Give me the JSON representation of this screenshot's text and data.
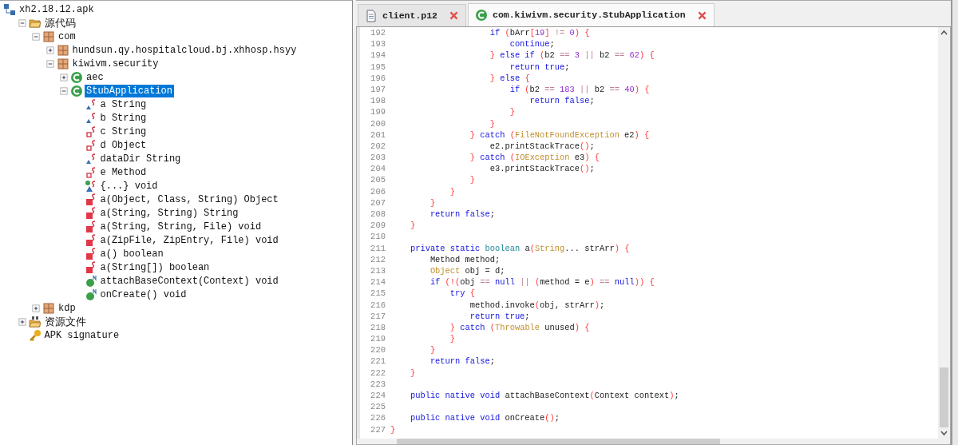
{
  "tree": {
    "label": "xh2.18.12.apk",
    "kind": "apk",
    "children": [
      {
        "label": "源代码",
        "kind": "folder",
        "expanded": true,
        "children": [
          {
            "label": "com",
            "kind": "package",
            "expanded": true,
            "children": [
              {
                "label": "hundsun.qy.hospitalcloud.bj.xhhosp.hsyy",
                "kind": "package",
                "expanded": false
              },
              {
                "label": "kiwivm.security",
                "kind": "package",
                "expanded": true,
                "children": [
                  {
                    "label": "aec",
                    "kind": "class",
                    "expanded": false,
                    "selected": false
                  },
                  {
                    "label": "StubApplication",
                    "kind": "class",
                    "expanded": true,
                    "selected": true,
                    "children": [
                      {
                        "label": "a String",
                        "kind": "final-field"
                      },
                      {
                        "label": "b String",
                        "kind": "final-field"
                      },
                      {
                        "label": "c String",
                        "kind": "private-field"
                      },
                      {
                        "label": "d Object",
                        "kind": "private-field"
                      },
                      {
                        "label": "dataDir String",
                        "kind": "final-field"
                      },
                      {
                        "label": "e Method",
                        "kind": "private-field"
                      },
                      {
                        "label": "{...} void",
                        "kind": "initializer"
                      },
                      {
                        "label": "a(Object, Class, String) Object",
                        "kind": "method"
                      },
                      {
                        "label": "a(String, String) String",
                        "kind": "method"
                      },
                      {
                        "label": "a(String, String, File) void",
                        "kind": "method"
                      },
                      {
                        "label": "a(ZipFile, ZipEntry, File) void",
                        "kind": "method"
                      },
                      {
                        "label": "a() boolean",
                        "kind": "method"
                      },
                      {
                        "label": "a(String[]) boolean",
                        "kind": "method"
                      },
                      {
                        "label": "attachBaseContext(Context) void",
                        "kind": "native"
                      },
                      {
                        "label": "onCreate() void",
                        "kind": "native"
                      }
                    ]
                  }
                ]
              }
            ]
          },
          {
            "label": "kdp",
            "kind": "package",
            "expanded": false
          }
        ]
      },
      {
        "label": "资源文件",
        "kind": "resources",
        "expanded": false
      },
      {
        "label": "APK signature",
        "kind": "key"
      }
    ]
  },
  "tabs": [
    {
      "label": "client.p12",
      "kind": "file",
      "selected": false
    },
    {
      "label": "com.kiwivm.security.StubApplication",
      "kind": "class",
      "selected": true
    }
  ],
  "code": [
    {
      "number": "192",
      "tokens": [
        {
          "kind": "keyword",
          "text": "                    if"
        },
        {
          "kind": "bracket",
          "text": " ("
        },
        {
          "kind": "plain",
          "text": "bArr"
        },
        {
          "kind": "bracket",
          "text": "["
        },
        {
          "kind": "number",
          "text": "19"
        },
        {
          "kind": "bracket",
          "text": "]"
        },
        {
          "kind": "operator",
          "text": " !="
        },
        {
          "kind": "number",
          "text": " 0"
        },
        {
          "kind": "bracket",
          "text": ")"
        },
        {
          "kind": "bracket",
          "text": " {"
        }
      ]
    },
    {
      "number": "193",
      "tokens": [
        {
          "kind": "keyword",
          "text": "                        continue"
        },
        {
          "kind": "plain",
          "text": ";"
        }
      ]
    },
    {
      "number": "194",
      "tokens": [
        {
          "kind": "bracket",
          "text": "                    }"
        },
        {
          "kind": "keyword",
          "text": " else if"
        },
        {
          "kind": "bracket",
          "text": " ("
        },
        {
          "kind": "plain",
          "text": "b2"
        },
        {
          "kind": "operator",
          "text": " =="
        },
        {
          "kind": "number",
          "text": " 3"
        },
        {
          "kind": "operator",
          "text": " ||"
        },
        {
          "kind": "plain",
          "text": " b2"
        },
        {
          "kind": "operator",
          "text": " =="
        },
        {
          "kind": "number",
          "text": " 62"
        },
        {
          "kind": "bracket",
          "text": ")"
        },
        {
          "kind": "bracket",
          "text": " {"
        }
      ]
    },
    {
      "number": "195",
      "tokens": [
        {
          "kind": "keyword",
          "text": "                        return true"
        },
        {
          "kind": "plain",
          "text": ";"
        }
      ]
    },
    {
      "number": "196",
      "tokens": [
        {
          "kind": "bracket",
          "text": "                    }"
        },
        {
          "kind": "keyword",
          "text": " else"
        },
        {
          "kind": "bracket",
          "text": " {"
        }
      ]
    },
    {
      "number": "197",
      "tokens": [
        {
          "kind": "keyword",
          "text": "                        if"
        },
        {
          "kind": "bracket",
          "text": " ("
        },
        {
          "kind": "plain",
          "text": "b2"
        },
        {
          "kind": "operator",
          "text": " =="
        },
        {
          "kind": "number",
          "text": " 183"
        },
        {
          "kind": "operator",
          "text": " ||"
        },
        {
          "kind": "plain",
          "text": " b2"
        },
        {
          "kind": "operator",
          "text": " =="
        },
        {
          "kind": "number",
          "text": " 40"
        },
        {
          "kind": "bracket",
          "text": ")"
        },
        {
          "kind": "bracket",
          "text": " {"
        }
      ]
    },
    {
      "number": "198",
      "tokens": [
        {
          "kind": "keyword",
          "text": "                            return false"
        },
        {
          "kind": "plain",
          "text": ";"
        }
      ]
    },
    {
      "number": "199",
      "tokens": [
        {
          "kind": "bracket",
          "text": "                        }"
        }
      ]
    },
    {
      "number": "200",
      "tokens": [
        {
          "kind": "bracket",
          "text": "                    }"
        }
      ]
    },
    {
      "number": "201",
      "tokens": [
        {
          "kind": "bracket",
          "text": "                }"
        },
        {
          "kind": "keyword",
          "text": " catch"
        },
        {
          "kind": "bracket",
          "text": " ("
        },
        {
          "kind": "type",
          "text": "FileNotFoundException"
        },
        {
          "kind": "plain",
          "text": " e2"
        },
        {
          "kind": "bracket",
          "text": ")"
        },
        {
          "kind": "bracket",
          "text": " {"
        }
      ]
    },
    {
      "number": "202",
      "tokens": [
        {
          "kind": "plain",
          "text": "                    e2.printStackTrace"
        },
        {
          "kind": "bracket",
          "text": "()"
        },
        {
          "kind": "plain",
          "text": ";"
        }
      ]
    },
    {
      "number": "203",
      "tokens": [
        {
          "kind": "bracket",
          "text": "                }"
        },
        {
          "kind": "keyword",
          "text": " catch"
        },
        {
          "kind": "bracket",
          "text": " ("
        },
        {
          "kind": "type",
          "text": "IOException"
        },
        {
          "kind": "plain",
          "text": " e3"
        },
        {
          "kind": "bracket",
          "text": ")"
        },
        {
          "kind": "bracket",
          "text": " {"
        }
      ]
    },
    {
      "number": "204",
      "tokens": [
        {
          "kind": "plain",
          "text": "                    e3.printStackTrace"
        },
        {
          "kind": "bracket",
          "text": "()"
        },
        {
          "kind": "plain",
          "text": ";"
        }
      ]
    },
    {
      "number": "205",
      "tokens": [
        {
          "kind": "bracket",
          "text": "                }"
        }
      ]
    },
    {
      "number": "206",
      "tokens": [
        {
          "kind": "bracket",
          "text": "            }"
        }
      ]
    },
    {
      "number": "207",
      "tokens": [
        {
          "kind": "bracket",
          "text": "        }"
        }
      ]
    },
    {
      "number": "208",
      "tokens": [
        {
          "kind": "keyword",
          "text": "        return false"
        },
        {
          "kind": "plain",
          "text": ";"
        }
      ]
    },
    {
      "number": "209",
      "tokens": [
        {
          "kind": "bracket",
          "text": "    }"
        }
      ]
    },
    {
      "number": "210"
    },
    {
      "number": "211",
      "tokens": [
        {
          "kind": "keyword",
          "text": "    private static"
        },
        {
          "kind": "primitive",
          "text": " boolean"
        },
        {
          "kind": "plain",
          "text": " a"
        },
        {
          "kind": "bracket",
          "text": "("
        },
        {
          "kind": "type",
          "text": "String"
        },
        {
          "kind": "plain",
          "text": "... strArr"
        },
        {
          "kind": "bracket",
          "text": ")"
        },
        {
          "kind": "bracket",
          "text": " {"
        }
      ]
    },
    {
      "number": "212",
      "tokens": [
        {
          "kind": "plain",
          "text": "        Method method;"
        }
      ]
    },
    {
      "number": "213",
      "tokens": [
        {
          "kind": "type",
          "text": "        Object"
        },
        {
          "kind": "plain",
          "text": " obj = d;"
        }
      ]
    },
    {
      "number": "214",
      "tokens": [
        {
          "kind": "keyword",
          "text": "        if"
        },
        {
          "kind": "bracket",
          "text": " (!("
        },
        {
          "kind": "plain",
          "text": "obj"
        },
        {
          "kind": "operator",
          "text": " =="
        },
        {
          "kind": "keyword",
          "text": " null"
        },
        {
          "kind": "operator",
          "text": " ||"
        },
        {
          "kind": "bracket",
          "text": " ("
        },
        {
          "kind": "plain",
          "text": "method = e"
        },
        {
          "kind": "bracket",
          "text": ")"
        },
        {
          "kind": "operator",
          "text": " =="
        },
        {
          "kind": "keyword",
          "text": " null"
        },
        {
          "kind": "bracket",
          "text": "))"
        },
        {
          "kind": "bracket",
          "text": " {"
        }
      ]
    },
    {
      "number": "215",
      "tokens": [
        {
          "kind": "keyword",
          "text": "            try"
        },
        {
          "kind": "bracket",
          "text": " {"
        }
      ]
    },
    {
      "number": "216",
      "tokens": [
        {
          "kind": "plain",
          "text": "                method.invoke"
        },
        {
          "kind": "bracket",
          "text": "("
        },
        {
          "kind": "plain",
          "text": "obj, strArr"
        },
        {
          "kind": "bracket",
          "text": ")"
        },
        {
          "kind": "plain",
          "text": ";"
        }
      ]
    },
    {
      "number": "217",
      "tokens": [
        {
          "kind": "keyword",
          "text": "                return true"
        },
        {
          "kind": "plain",
          "text": ";"
        }
      ]
    },
    {
      "number": "218",
      "tokens": [
        {
          "kind": "bracket",
          "text": "            }"
        },
        {
          "kind": "keyword",
          "text": " catch"
        },
        {
          "kind": "bracket",
          "text": " ("
        },
        {
          "kind": "type",
          "text": "Throwable"
        },
        {
          "kind": "plain",
          "text": " unused"
        },
        {
          "kind": "bracket",
          "text": ")"
        },
        {
          "kind": "bracket",
          "text": " {"
        }
      ]
    },
    {
      "number": "219",
      "tokens": [
        {
          "kind": "bracket",
          "text": "            }"
        }
      ]
    },
    {
      "number": "220",
      "tokens": [
        {
          "kind": "bracket",
          "text": "        }"
        }
      ]
    },
    {
      "number": "221",
      "tokens": [
        {
          "kind": "keyword",
          "text": "        return false"
        },
        {
          "kind": "plain",
          "text": ";"
        }
      ]
    },
    {
      "number": "222",
      "tokens": [
        {
          "kind": "bracket",
          "text": "    }"
        }
      ]
    },
    {
      "number": "223"
    },
    {
      "number": "224",
      "tokens": [
        {
          "kind": "keyword",
          "text": "    public native void"
        },
        {
          "kind": "plain",
          "text": " attachBaseContext"
        },
        {
          "kind": "bracket",
          "text": "("
        },
        {
          "kind": "plain",
          "text": "Context context"
        },
        {
          "kind": "bracket",
          "text": ")"
        },
        {
          "kind": "plain",
          "text": ";"
        }
      ]
    },
    {
      "number": "225"
    },
    {
      "number": "226",
      "tokens": [
        {
          "kind": "keyword",
          "text": "    public native void"
        },
        {
          "kind": "plain",
          "text": " onCreate"
        },
        {
          "kind": "bracket",
          "text": "()"
        },
        {
          "kind": "plain",
          "text": ";"
        }
      ]
    },
    {
      "number": "227",
      "tokens": [
        {
          "kind": "bracket",
          "text": "}"
        }
      ]
    }
  ]
}
